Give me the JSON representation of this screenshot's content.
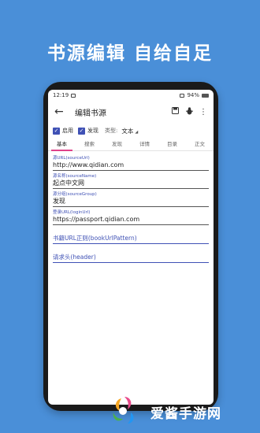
{
  "banner": {
    "title": "书源编辑  自给自足"
  },
  "statusbar": {
    "time": "12:19",
    "battery": "94%"
  },
  "appbar": {
    "title": "编辑书源"
  },
  "options": {
    "enabled_label": "启用",
    "discover_label": "发现",
    "type_label": "类型:",
    "type_value": "文本"
  },
  "tabs": [
    "基本",
    "搜索",
    "发现",
    "详情",
    "目录",
    "正文"
  ],
  "fields": [
    {
      "label": "源URL(sourceUrl)",
      "value": "http://www.qidian.com"
    },
    {
      "label": "源名称(sourceName)",
      "value": "起点中文网"
    },
    {
      "label": "源分组(sourceGroup)",
      "value": "发现"
    },
    {
      "label": "登录URL(loginUrl)",
      "value": "https://passport.qidian.com"
    }
  ],
  "placeholders": [
    {
      "label": "书籍URL正则(bookUrlPattern)"
    },
    {
      "label": "请求头(header)"
    }
  ],
  "watermark": {
    "text": "爱酱手游网"
  },
  "colors": {
    "background": "#4a8fd8",
    "accent": "#3f51b5",
    "tab_indicator": "#e0428a"
  },
  "icons": [
    "back-arrow-icon",
    "save-icon",
    "bug-icon",
    "more-vert-icon",
    "checkbox-checked-icon",
    "dropdown-arrow-icon"
  ]
}
